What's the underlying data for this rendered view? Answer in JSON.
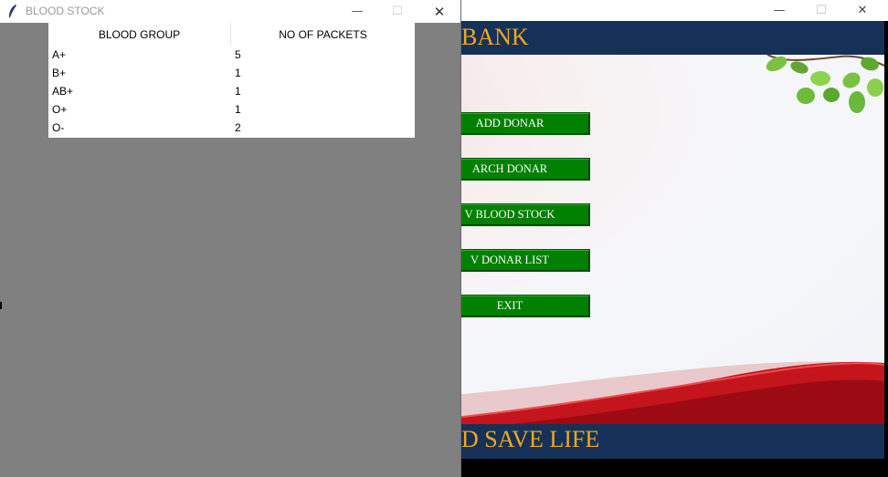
{
  "main_window": {
    "controls": {
      "minimize": "—",
      "maximize": "☐",
      "close": "✕"
    },
    "header_text": "BANK",
    "footer_text": "D SAVE LIFE",
    "menu_buttons": [
      {
        "label": "ADD DONAR"
      },
      {
        "label": "ARCH DONAR"
      },
      {
        "label": "V BLOOD STOCK"
      },
      {
        "label": "V DONAR LIST"
      },
      {
        "label": "EXIT"
      }
    ],
    "colors": {
      "banner": "#153158",
      "banner_text": "#f2a81b",
      "button": "#008000",
      "wave": "#c4141c"
    }
  },
  "stock_window": {
    "title": "BLOOD STOCK",
    "controls": {
      "minimize": "—",
      "maximize": "☐",
      "close": "✕"
    },
    "table": {
      "headers": [
        "BLOOD GROUP",
        "NO OF PACKETS"
      ],
      "rows": [
        [
          "A+",
          "5"
        ],
        [
          "B+",
          "1"
        ],
        [
          "AB+",
          "1"
        ],
        [
          "O+",
          "1"
        ],
        [
          "O-",
          "2"
        ]
      ]
    },
    "colors": {
      "body": "#808080"
    }
  }
}
